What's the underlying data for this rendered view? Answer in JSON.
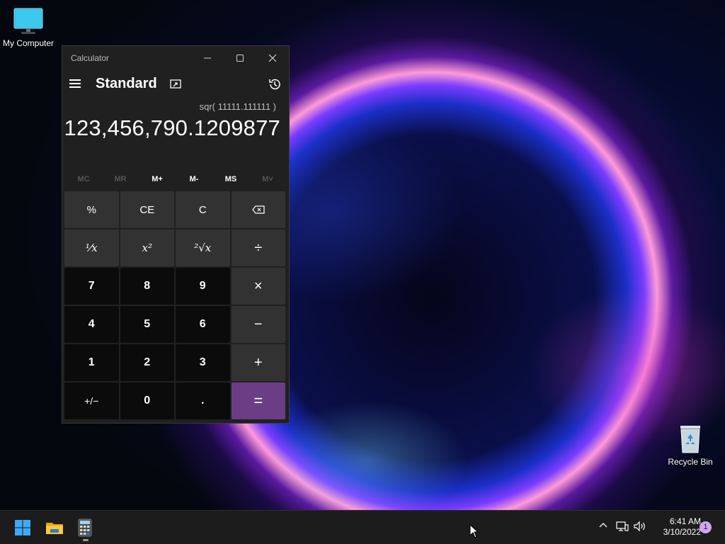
{
  "desktop": {
    "icons": [
      {
        "label": "My Computer"
      },
      {
        "label": "Recycle Bin"
      }
    ]
  },
  "calculator": {
    "window_title": "Calculator",
    "mode": "Standard",
    "expression": "sqr( 11111.111111 )",
    "result": "123,456,790.1209877",
    "memory": [
      "MC",
      "MR",
      "M+",
      "M-",
      "MS",
      "M˅"
    ],
    "keys": [
      "%",
      "CE",
      "C",
      "⌫",
      "⅟x",
      "x²",
      "²√x",
      "÷",
      "7",
      "8",
      "9",
      "×",
      "4",
      "5",
      "6",
      "−",
      "1",
      "2",
      "3",
      "+",
      "+/−",
      "0",
      ".",
      "="
    ],
    "accent": "#6b3d85"
  },
  "taskbar": {
    "time": "6:41 AM",
    "date": "3/10/2022",
    "notifications": "1"
  }
}
